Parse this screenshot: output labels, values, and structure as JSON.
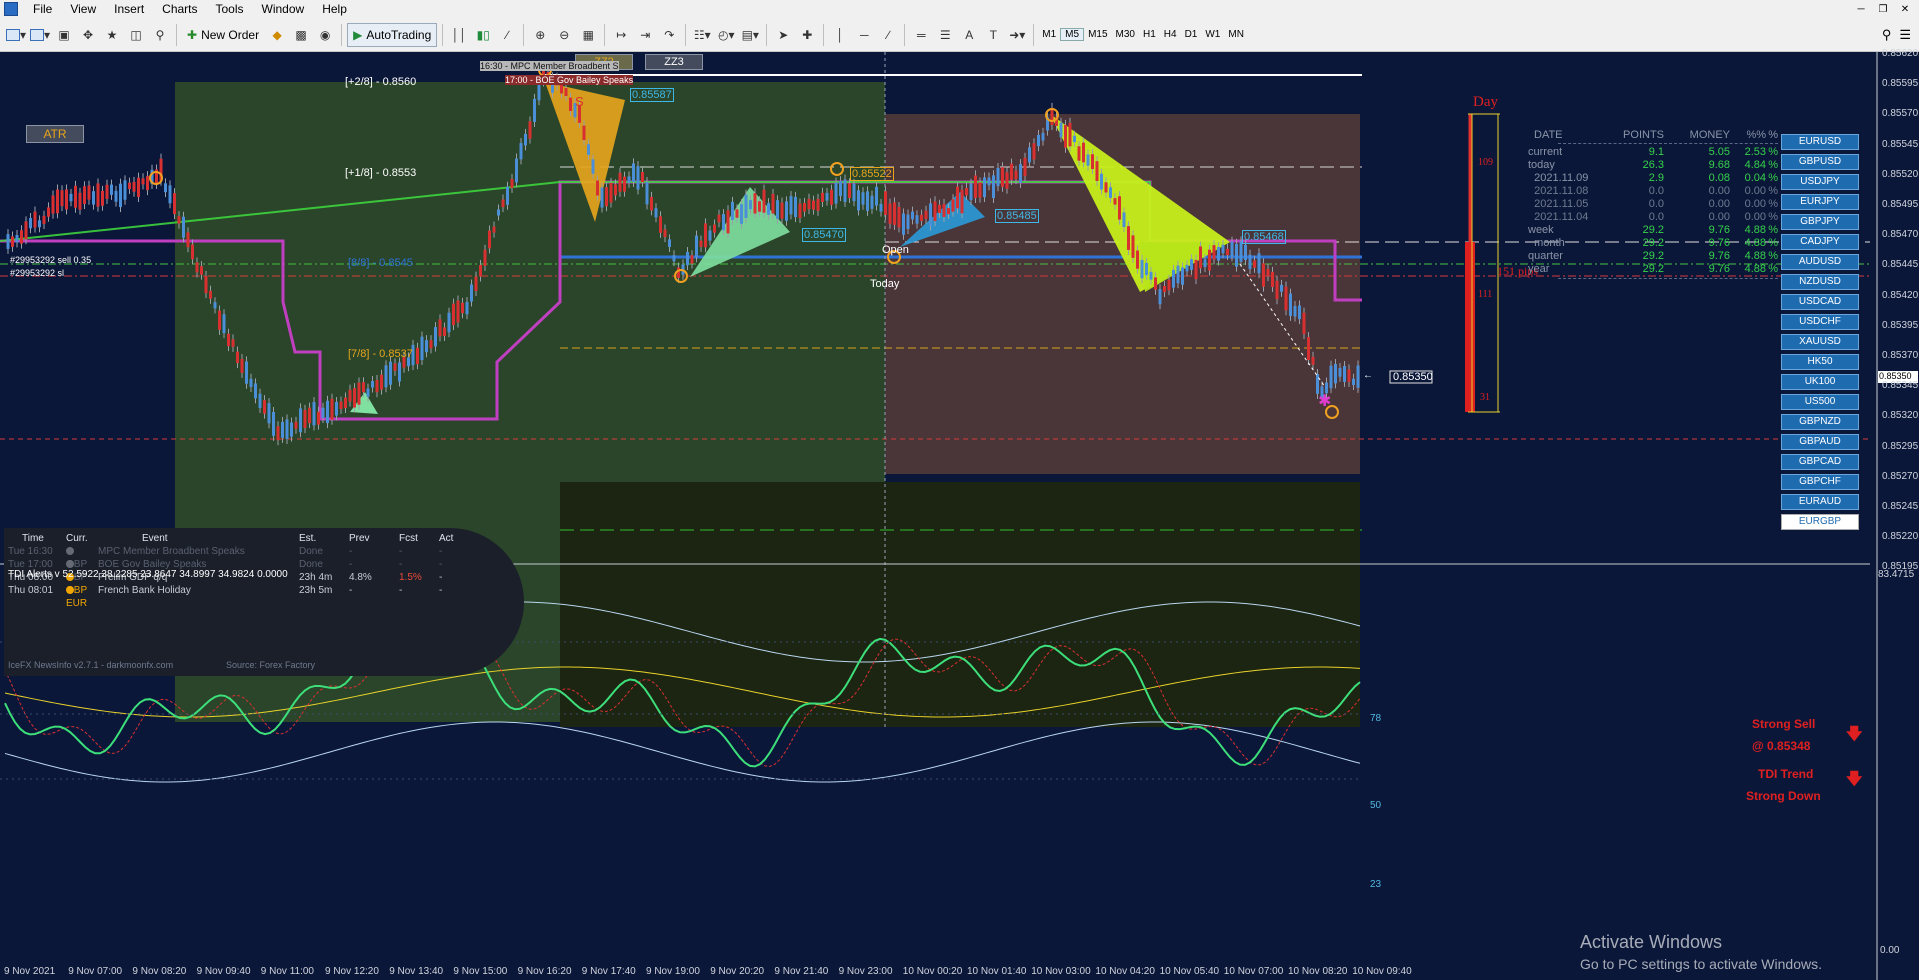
{
  "menu": [
    "File",
    "View",
    "Insert",
    "Charts",
    "Tools",
    "Window",
    "Help"
  ],
  "toolbar": {
    "new_order": "New Order",
    "autotrading": "AutoTrading",
    "timeframes": [
      "M1",
      "M5",
      "M15",
      "M30",
      "H1",
      "H4",
      "D1",
      "W1",
      "MN"
    ],
    "active_timeframe": "M5"
  },
  "chart": {
    "atr_label": "ATR",
    "zz2_label": "ZZ2",
    "zz3_label": "ZZ3",
    "order_sell_label": "#29953292 sell 0.35",
    "order_sl_label": "#29953292 sl",
    "level_plus2": "[+2/8] - 0.8560",
    "level_plus1": "[+1/8] - 0.8553",
    "level_8_8": "[8/8] - 0.8545",
    "level_7_8": "[7/8] - 0.8537",
    "news_top_line1": "16:30 - MPC Member Broadbent S",
    "news_top_line2": "17:00 - BOE Gov Bailey Speaks",
    "label_s": "S",
    "price_85587": "0.85587",
    "price_85522": "0.85522",
    "price_85470": "0.85470",
    "price_85485": "0.85485",
    "price_85468": "0.85468",
    "price_current": "0.85350",
    "open_label": "Open",
    "today_label": "Today",
    "day_label": "Day",
    "day_values": [
      "109",
      "111",
      "31"
    ],
    "pips_label": "151 pips",
    "current_price_axis": "0.85350"
  },
  "stats": {
    "headers": [
      "DATE",
      "POINTS",
      "MONEY",
      "%%",
      "%"
    ],
    "rows": [
      {
        "label": "current",
        "points": "9.1",
        "money": "5.05",
        "pct": "2.53",
        "sym": "%",
        "dim": false
      },
      {
        "label": "today",
        "points": "26.3",
        "money": "9.68",
        "pct": "4.84",
        "sym": "%",
        "dim": false
      },
      {
        "label": "  2021.11.09",
        "points": "2.9",
        "money": "0.08",
        "pct": "0.04",
        "sym": "%",
        "dim": false
      },
      {
        "label": "  2021.11.08",
        "points": "0.0",
        "money": "0.00",
        "pct": "0.00",
        "sym": "%",
        "dim": true
      },
      {
        "label": "  2021.11.05",
        "points": "0.0",
        "money": "0.00",
        "pct": "0.00",
        "sym": "%",
        "dim": true
      },
      {
        "label": "  2021.11.04",
        "points": "0.0",
        "money": "0.00",
        "pct": "0.00",
        "sym": "%",
        "dim": true
      },
      {
        "label": "week",
        "points": "29.2",
        "money": "9.76",
        "pct": "4.88",
        "sym": "%",
        "dim": false
      },
      {
        "label": "  month",
        "points": "29.2",
        "money": "9.76",
        "pct": "4.88",
        "sym": "%",
        "dim": false
      },
      {
        "label": "quarter",
        "points": "29.2",
        "money": "9.76",
        "pct": "4.88",
        "sym": "%",
        "dim": false
      },
      {
        "label": "year",
        "points": "29.2",
        "money": "9.76",
        "pct": "4.88",
        "sym": "%",
        "dim": false
      }
    ]
  },
  "symbols": [
    "EURUSD",
    "GBPUSD",
    "USDJPY",
    "EURJPY",
    "GBPJPY",
    "CADJPY",
    "AUDUSD",
    "NZDUSD",
    "USDCAD",
    "USDCHF",
    "XAUUSD",
    "HK50",
    "UK100",
    "US500",
    "GBPNZD",
    "GBPAUD",
    "GBPCAD",
    "GBPCHF",
    "EURAUD",
    "EURGBP"
  ],
  "active_symbol": "EURGBP",
  "price_axis": [
    "0.85620",
    "0.85595",
    "0.85570",
    "0.85545",
    "0.85520",
    "0.85495",
    "0.85470",
    "0.85445",
    "0.85420",
    "0.85395",
    "0.85370",
    "0.85345",
    "0.85320",
    "0.85295",
    "0.85270",
    "0.85245",
    "0.85220",
    "0.85195"
  ],
  "news": {
    "headers": [
      "Time",
      "Curr.",
      "Event",
      "Est.",
      "Prev",
      "Fcst",
      "Act"
    ],
    "rows": [
      {
        "time": "Tue  16:30",
        "curr": "GBP",
        "event": "MPC Member Broadbent Speaks",
        "est": "Done",
        "prev": "-",
        "fcst": "-",
        "act": "-",
        "dot": "#666a72",
        "dim": true,
        "fcst_color": "#5a6070"
      },
      {
        "time": "Tue  17:00",
        "curr": "GBP",
        "event": "BOE Gov Bailey Speaks",
        "est": "Done",
        "prev": "-",
        "fcst": "-",
        "act": "-",
        "dot": "#666a72",
        "dim": true,
        "fcst_color": "#5a6070"
      },
      {
        "time": "Thu  08:00",
        "curr": "GBP",
        "event": "Prelim GDP q/q",
        "est": "23h 4m",
        "prev": "4.8%",
        "fcst": "1.5%",
        "act": "-",
        "dot": "#f0a500",
        "dim": false,
        "fcst_color": "#e84b3a"
      },
      {
        "time": "Thu  08:01",
        "curr": "EUR",
        "event": "French Bank Holiday",
        "est": "23h 5m",
        "prev": "-",
        "fcst": "-",
        "act": "-",
        "dot": "#f0a500",
        "dim": false,
        "fcst_color": "#c8ccd4"
      }
    ],
    "footer_version": "IceFX NewsInfo v2.7.1  -  darkmoonfx.com",
    "footer_source": "Source: Forex Factory"
  },
  "indicator": {
    "title": "TDI Alerts v 52.5922 38.2285 23.8647 34.8997 34.9824 0.0000",
    "axis_top": "83.4715",
    "axis_bottom": "0.00",
    "levels": [
      "78",
      "50",
      "23"
    ],
    "signal1": "Strong Sell",
    "signal2": "@ 0.85348",
    "signal3": "TDI Trend",
    "signal4": "Strong Down"
  },
  "time_axis": [
    "9 Nov 2021",
    "9 Nov 07:00",
    "9 Nov 08:20",
    "9 Nov 09:40",
    "9 Nov 11:00",
    "9 Nov 12:20",
    "9 Nov 13:40",
    "9 Nov 15:00",
    "9 Nov 16:20",
    "9 Nov 17:40",
    "9 Nov 19:00",
    "9 Nov 20:20",
    "9 Nov 21:40",
    "9 Nov 23:00",
    "10 Nov 00:20",
    "10 Nov 01:40",
    "10 Nov 03:00",
    "10 Nov 04:20",
    "10 Nov 05:40",
    "10 Nov 07:00",
    "10 Nov 08:20",
    "10 Nov 09:40"
  ],
  "watermark": {
    "line1": "Activate Windows",
    "line2": "Go to PC settings to activate Windows."
  }
}
